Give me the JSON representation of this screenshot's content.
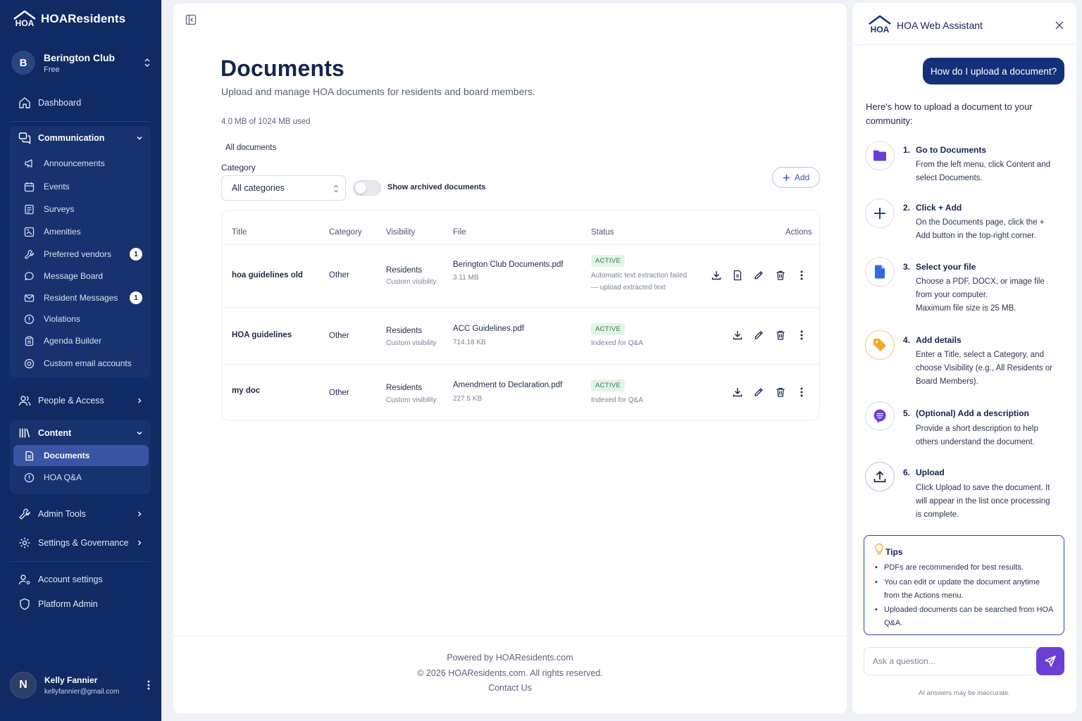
{
  "app": {
    "name": "HOAResidents"
  },
  "club": {
    "initial": "B",
    "name": "Berington Club",
    "plan": "Free"
  },
  "nav": {
    "dashboard": "Dashboard",
    "communication": "Communication",
    "communication_items": [
      {
        "label": "Announcements",
        "icon": "megaphone-icon"
      },
      {
        "label": "Events",
        "icon": "calendar-icon"
      },
      {
        "label": "Surveys",
        "icon": "survey-icon"
      },
      {
        "label": "Amenities",
        "icon": "amenities-icon"
      },
      {
        "label": "Preferred vendors",
        "icon": "wrench-icon",
        "badge": "1"
      },
      {
        "label": "Message Board",
        "icon": "chat-icon"
      },
      {
        "label": "Resident Messages",
        "icon": "mail-icon",
        "badge": "1"
      },
      {
        "label": "Violations",
        "icon": "alert-icon"
      },
      {
        "label": "Agenda Builder",
        "icon": "clipboard-icon"
      },
      {
        "label": "Custom email accounts",
        "icon": "at-icon"
      }
    ],
    "people_access": "People & Access",
    "content": "Content",
    "content_items": [
      {
        "label": "Documents",
        "icon": "document-icon",
        "active": true
      },
      {
        "label": "HOA Q&A",
        "icon": "question-icon"
      }
    ],
    "admin_tools": "Admin Tools",
    "settings_governance": "Settings & Governance",
    "account_settings": "Account settings",
    "platform_admin": "Platform Admin"
  },
  "user": {
    "initial": "N",
    "name": "Kelly Fannier",
    "email": "kellyfannier@gmail.com"
  },
  "main": {
    "title": "Documents",
    "subtitle": "Upload and manage HOA documents for residents and board members.",
    "usage": "4.0 MB of 1024 MB used",
    "tab": "All documents",
    "category_label": "Category",
    "category_value": "All categories",
    "archived_toggle_label": "Show archived documents",
    "archived_toggle_on": false,
    "add_label": "Add",
    "table": {
      "headers": {
        "title": "Title",
        "category": "Category",
        "visibility": "Visibility",
        "file": "File",
        "status": "Status",
        "actions": "Actions"
      },
      "rows": [
        {
          "title": "hoa guidelines old",
          "category": "Other",
          "visibility": "Residents",
          "visibility_sub": "Custom visibility",
          "file": "Berington Club Documents.pdf",
          "size": "3.11 MB",
          "status": "ACTIVE",
          "status_line1": "Automatic text extraction failed",
          "status_line2": "— upload extracted text"
        },
        {
          "title": "HOA guidelines",
          "category": "Other",
          "visibility": "Residents",
          "visibility_sub": "Custom visibility",
          "file": "ACC Guidelines.pdf",
          "size": "714.18 KB",
          "status": "ACTIVE",
          "status_line1": "Indexed for Q&A"
        },
        {
          "title": "my doc",
          "category": "Other",
          "visibility": "Residents",
          "visibility_sub": "Custom visibility",
          "file": "Amendment to Declaration.pdf",
          "size": "227.5 KB",
          "status": "ACTIVE",
          "status_line1": "Indexed for Q&A"
        }
      ]
    },
    "footer": {
      "powered": "Powered by  HOAResidents.com",
      "copyright": "© 2026 HOAResidents.com. All rights reserved.",
      "contact": "Contact Us"
    }
  },
  "assistant": {
    "title": "HOA Web Assistant",
    "question": "How do I upload a document?",
    "intro": "Here's how to upload a document to your community:",
    "steps": [
      {
        "num": "1.",
        "title": "Go to Documents",
        "body": "From the left menu, click Content and select Documents.",
        "icon": "folder-icon",
        "color": "#6c3fd4"
      },
      {
        "num": "2.",
        "title": "Click + Add",
        "body": "On the Documents page, click the + Add button in the top-right corner.",
        "icon": "plus-icon",
        "color": "#13307a"
      },
      {
        "num": "3.",
        "title": "Select your file",
        "body_lines": [
          "Choose a PDF, DOCX, or image file from your computer.",
          "Maximum file size is 25 MB."
        ],
        "icon": "file-icon",
        "color": "#2f6be0"
      },
      {
        "num": "4.",
        "title": "Add details",
        "body": "Enter a Title, select a Category, and choose Visibility (e.g., All Residents or Board Members).",
        "icon": "tag-icon",
        "color": "#f5a623"
      },
      {
        "num": "5.",
        "title": "(Optional) Add a description",
        "body": "Provide a short description to help others understand the document.",
        "icon": "message-icon",
        "color": "#6c3fd4"
      },
      {
        "num": "6.",
        "title": "Upload",
        "body": "Click Upload to save the document. It will appear in the list once processing is complete.",
        "icon": "upload-icon",
        "color": "#1e2a4a"
      }
    ],
    "tips_title": "Tips",
    "tips": [
      "PDFs are recommended for best results.",
      "You can edit or update the document anytime from the Actions menu.",
      "Uploaded documents can be searched from HOA Q&A."
    ],
    "input_placeholder": "Ask a question...",
    "disclaimer": "AI answers may be inaccurate."
  }
}
